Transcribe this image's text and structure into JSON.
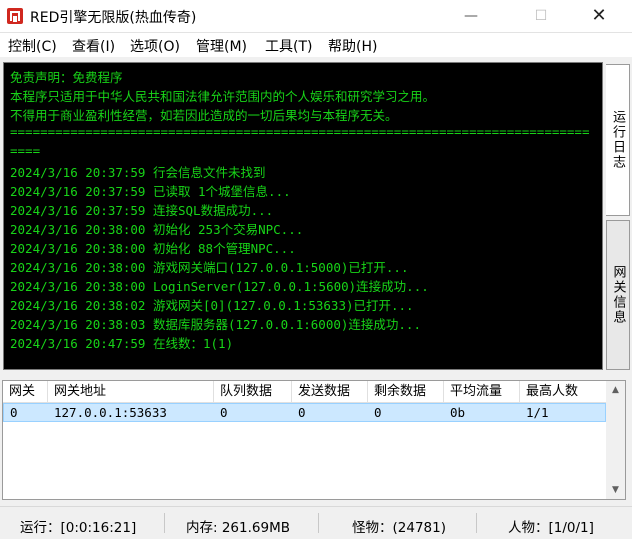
{
  "window": {
    "title": "RED引擎无限版(热血传奇)",
    "min_glyph": "—",
    "max_glyph": "☐",
    "close_glyph": "✕"
  },
  "menu": [
    "控制(C)",
    "查看(I)",
    "选项(O)",
    "管理(M)",
    "工具(T)",
    "帮助(H)"
  ],
  "console": {
    "lines": [
      "免责声明：免费程序",
      "本程序只适用于中华人民共和国法律允许范围内的个人娱乐和研究学习之用。",
      "不得用于商业盈利性经营，如若因此造成的一切后果均与本程序无关。",
      "=============================================================================",
      "====",
      "2024/3/16 20:37:59 行会信息文件未找到",
      "2024/3/16 20:37:59 已读取 1个城堡信息...",
      "2024/3/16 20:37:59 连接SQL数据成功...",
      "2024/3/16 20:38:00 初始化 253个交易NPC...",
      "2024/3/16 20:38:00 初始化 88个管理NPC...",
      "2024/3/16 20:38:00 游戏网关端口(127.0.0.1:5000)已打开...",
      "2024/3/16 20:38:00 LoginServer(127.0.0.1:5600)连接成功...",
      "2024/3/16 20:38:02 游戏网关[0](127.0.0.1:53633)已打开...",
      "2024/3/16 20:38:03 数据库服务器(127.0.0.1:6000)连接成功...",
      "2024/3/16 20:47:59 在线数：1(1)"
    ],
    "text_color": "#18d418"
  },
  "tabs": {
    "log": "运行日志",
    "gateway": "网关信息"
  },
  "grid": {
    "headers": [
      "网关",
      "网关地址",
      "队列数据",
      "发送数据",
      "剩余数据",
      "平均流量",
      "最高人数"
    ],
    "rows": [
      [
        "0",
        "127.0.0.1:53633",
        "0",
        "0",
        "0",
        "0b",
        "1/1"
      ]
    ],
    "up_arrow": "▲",
    "down_arrow": "▼"
  },
  "status": {
    "runtime": "运行：[0:0:16:21]",
    "memory": "内存: 261.69MB",
    "monsters": "怪物：(24781)",
    "players": "人物：[1/0/1]"
  }
}
